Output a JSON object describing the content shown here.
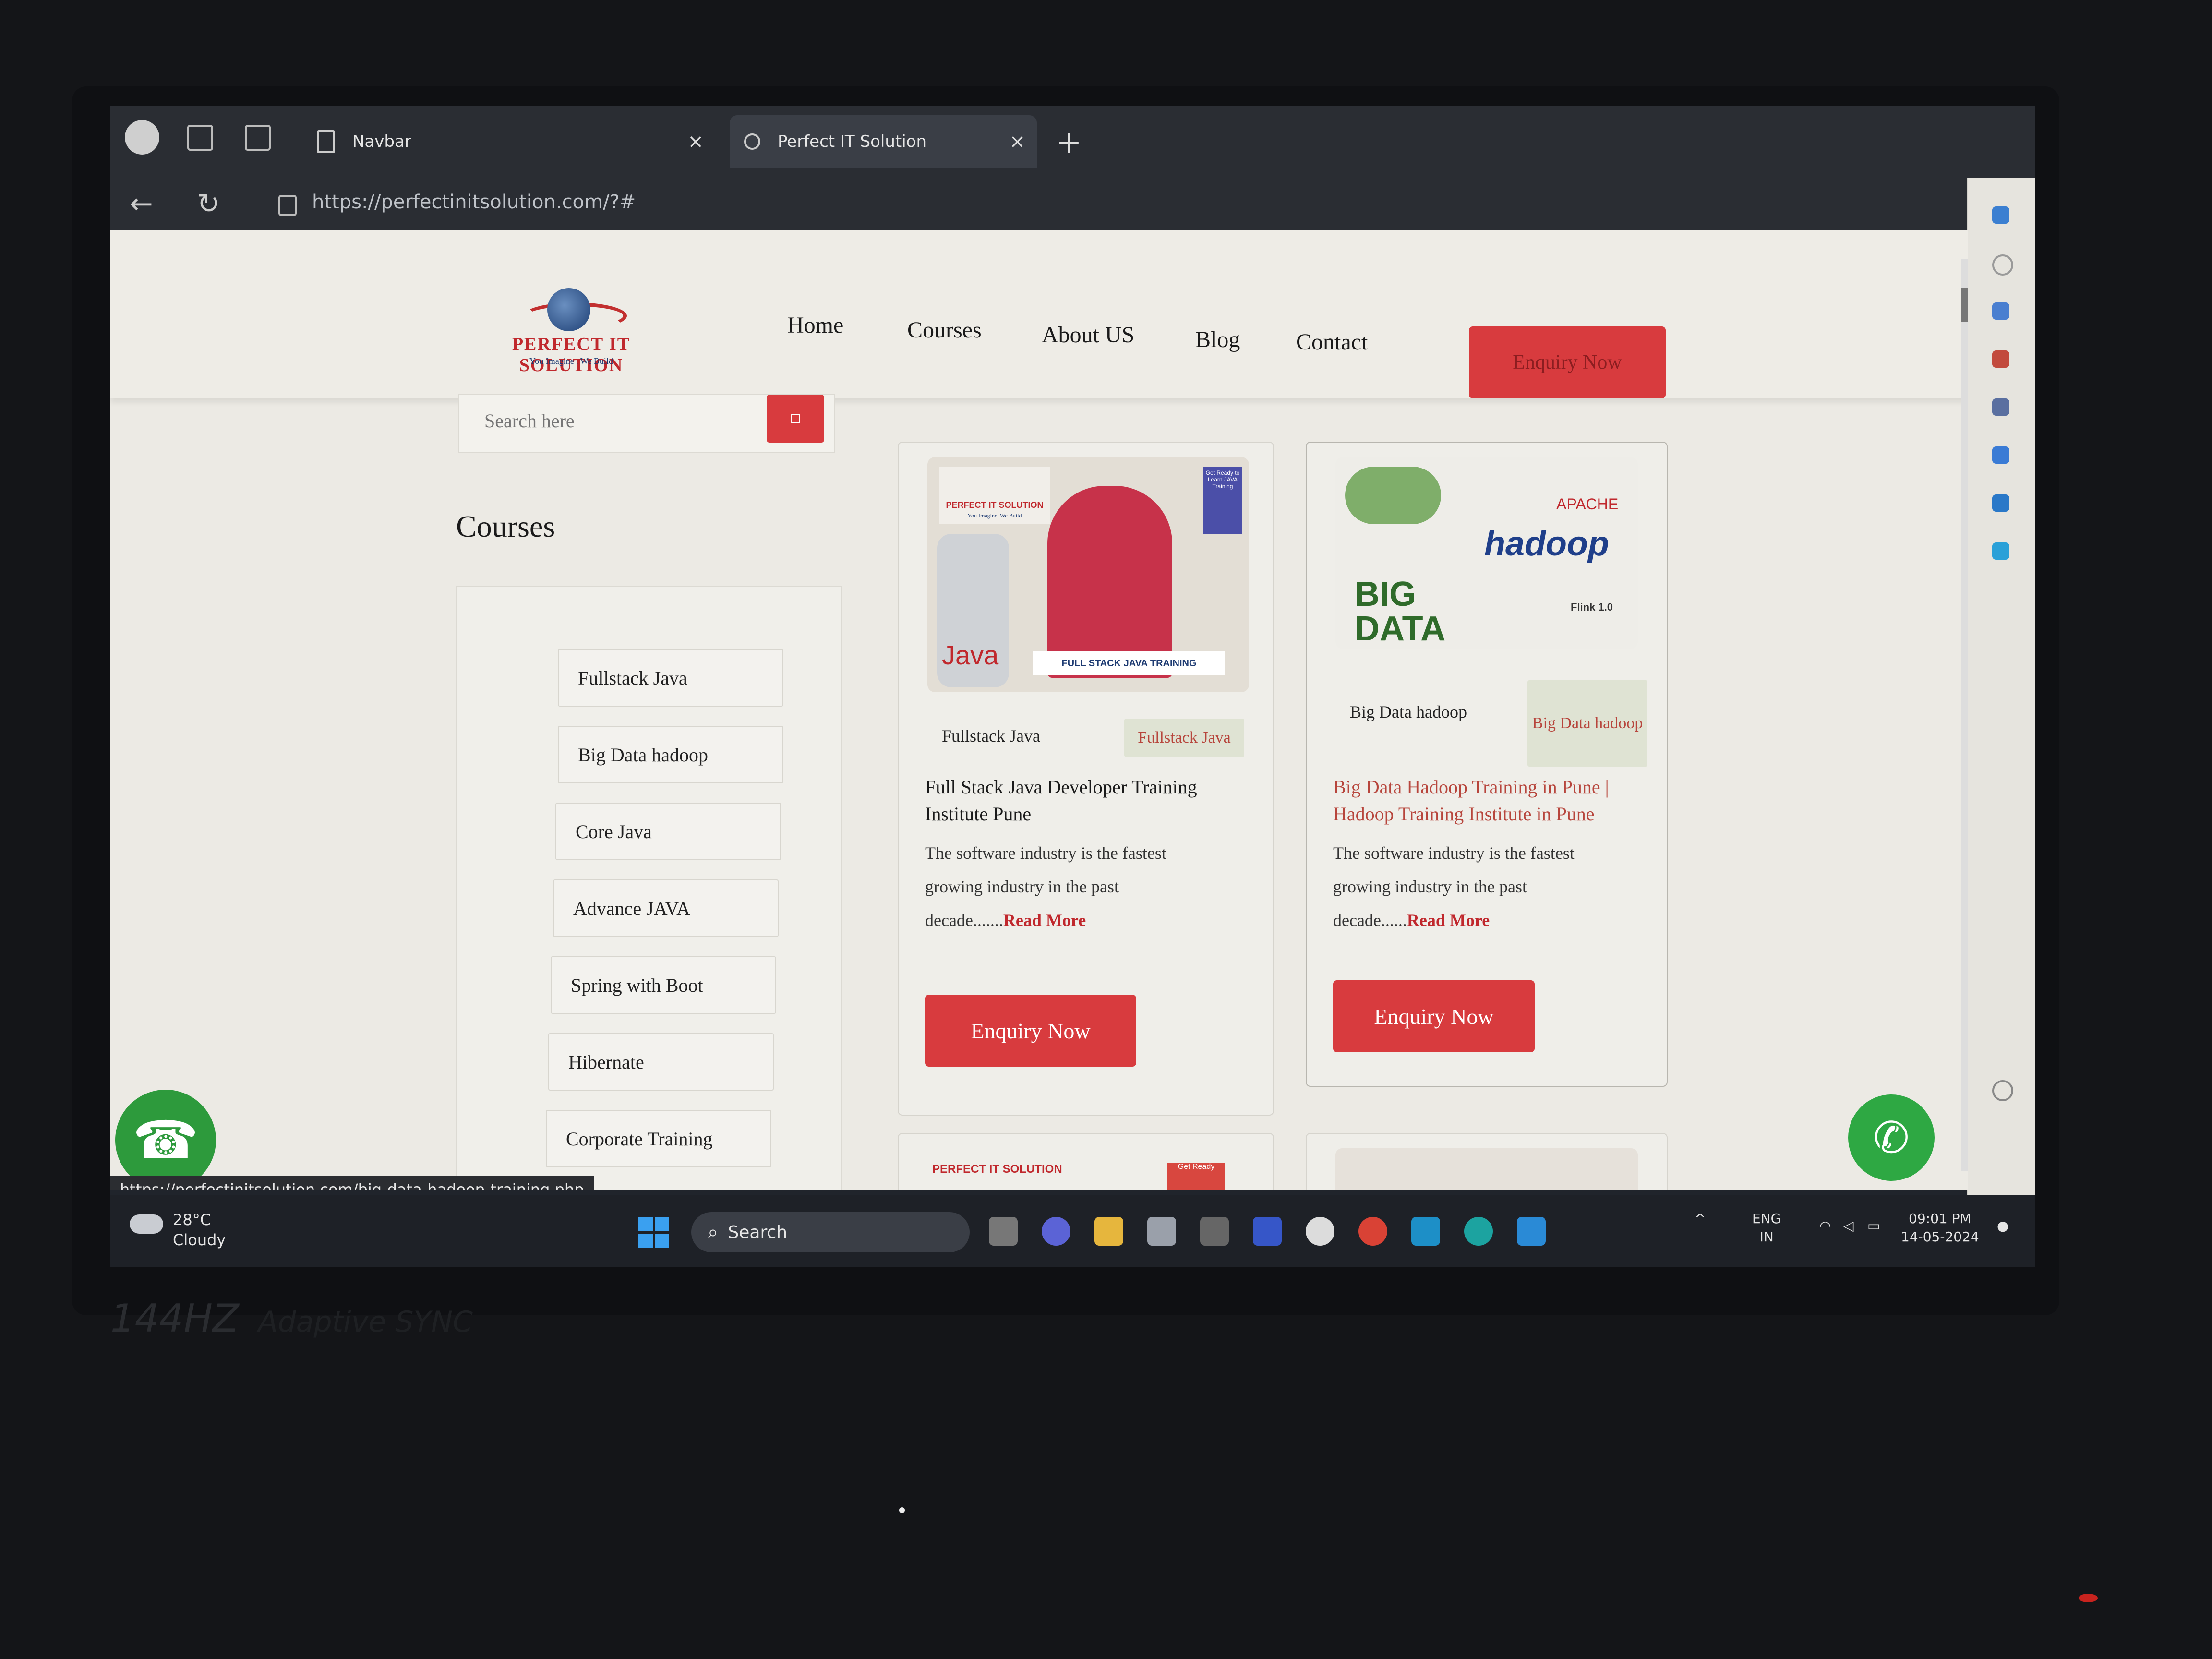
{
  "browser": {
    "tabs": [
      {
        "label": "Navbar"
      },
      {
        "label": "Perfect IT Solution"
      }
    ],
    "new_tab": "+",
    "close_glyph": "×",
    "url": "https://perfectinitsolution.com/?#",
    "back_icon": "←",
    "reload_icon": "↻"
  },
  "site": {
    "logo_text": "PERFECT IT SOLUTION",
    "logo_tagline": "You Imagine . We Build",
    "nav": [
      "Home",
      "Courses",
      "About US",
      "Blog",
      "Contact"
    ],
    "enquiry_label": "Enquiry Now",
    "search_placeholder": "Search here",
    "courses_heading": "Courses",
    "course_list": [
      "Fullstack Java",
      "Big Data hadoop",
      "Core Java",
      "Advance JAVA",
      "Spring with Boot",
      "Hibernate",
      "Corporate Training"
    ],
    "cards": [
      {
        "category": "Fullstack Java",
        "chip": "Fullstack Java",
        "title": "Full Stack Java Developer Training Institute Pune",
        "desc_1": "The software industry is the fastest",
        "desc_2": "growing industry in the past",
        "desc_3": "decade.......",
        "read_more": "Read More",
        "button": "Enquiry Now",
        "img_brand": "PERFECT IT SOLUTION",
        "img_brand_tag": "You Imagine, We Build",
        "img_badge": "Get Ready to Learn JAVA Training",
        "img_java": "Java",
        "img_caption": "FULL STACK JAVA TRAINING"
      },
      {
        "category": "Big Data hadoop",
        "chip": "Big Data hadoop",
        "title": "Big Data Hadoop Training in Pune | Hadoop Training Institute in Pune",
        "desc_1": "The software industry is the fastest",
        "desc_2": "growing industry in the past",
        "desc_3": "decade......",
        "read_more": "Read More",
        "button": "Enquiry Now",
        "img_big": "BIG DATA",
        "img_apache": "APACHE",
        "img_hadoop": "hadoop",
        "img_flink": "Flink 1.0"
      }
    ],
    "peek_card_brand": "PERFECT IT SOLUTION",
    "peek_card_badge": "Get Ready",
    "status_url": "https://perfectinitsolution.com/big-data-hadoop-training.php"
  },
  "taskbar": {
    "temp": "28°C",
    "condition": "Cloudy",
    "search_label": "Search",
    "lang_1": "ENG",
    "lang_2": "IN",
    "time": "09:01 PM",
    "date": "14-05-2024"
  },
  "laptop": {
    "refresh_badge": "144HZ",
    "sync_badge": "Adaptive SYNC"
  },
  "colors": {
    "accent_red": "#d83b3e",
    "whatsapp_green": "#2ea843",
    "call_green": "#2d9a3c"
  }
}
